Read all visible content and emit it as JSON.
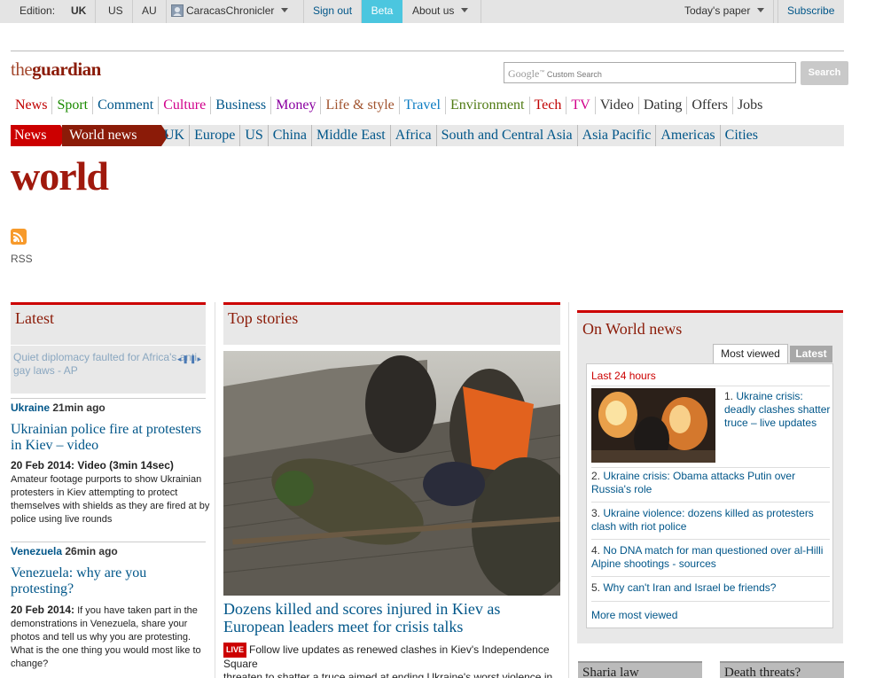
{
  "topbar": {
    "edition_label": "Edition:",
    "editions": [
      "UK",
      "US",
      "AU"
    ],
    "username": "CaracasChronicler",
    "sign_out": "Sign out",
    "beta": "Beta",
    "about": "About us",
    "todays_paper": "Today's paper",
    "subscribe": "Subscribe"
  },
  "logo": {
    "the": "the",
    "name": "guardian"
  },
  "search": {
    "brand": "Google",
    "placeholder": "Custom Search",
    "button": "Search"
  },
  "nav": [
    {
      "label": "News",
      "color": "#c00000"
    },
    {
      "label": "Sport",
      "color": "#1a8a00"
    },
    {
      "label": "Comment",
      "color": "#005689"
    },
    {
      "label": "Culture",
      "color": "#d1008b"
    },
    {
      "label": "Business",
      "color": "#005689"
    },
    {
      "label": "Money",
      "color": "#8a00a0"
    },
    {
      "label": "Life & style",
      "color": "#a0522d"
    },
    {
      "label": "Travel",
      "color": "#0a7bc2"
    },
    {
      "label": "Environment",
      "color": "#4f7a12"
    },
    {
      "label": "Tech",
      "color": "#c00000"
    },
    {
      "label": "TV",
      "color": "#d1008b"
    },
    {
      "label": "Video",
      "color": "#333333"
    },
    {
      "label": "Dating",
      "color": "#333333"
    },
    {
      "label": "Offers",
      "color": "#333333"
    },
    {
      "label": "Jobs",
      "color": "#333333"
    }
  ],
  "subnav": {
    "news": "News",
    "world_news": "World news",
    "items": [
      "UK",
      "Europe",
      "US",
      "China",
      "Middle East",
      "Africa",
      "South and Central Asia",
      "Asia Pacific",
      "Americas",
      "Cities"
    ]
  },
  "page_title": "world",
  "rss_label": "RSS",
  "latest": {
    "heading": "Latest",
    "ticker": "Quiet diplomacy faulted for Africa's anti-gay laws - AP",
    "stories": [
      {
        "section": "Ukraine",
        "age": "21min ago",
        "headline": "Ukrainian police fire at protesters in Kiev – video",
        "date": "20 Feb 2014: Video (3min 14sec)",
        "standfirst": "Amateur footage purports to show Ukrainian protesters in Kiev attempting to protect themselves with shields as they are fired at by police using live rounds"
      },
      {
        "section": "Venezuela",
        "age": "26min ago",
        "headline": "Venezuela: why are you protesting?",
        "date": "20 Feb 2014:",
        "standfirst": "If you have taken part in the demonstrations in Venezuela, share your photos and tell us why you are protesting. What is the one thing you would most like to change?"
      }
    ]
  },
  "top_stories": {
    "heading": "Top stories",
    "headline": "Dozens killed and scores injured in Kiev as European leaders meet for crisis talks",
    "live_badge": "LIVE",
    "standfirst": "Follow live updates as renewed clashes in Kiev's Independence Square",
    "standfirst2": "threaten to shatter a truce aimed at ending Ukraine's worst violence in"
  },
  "on_world_news": {
    "heading": "On World news",
    "tab_most_viewed": "Most viewed",
    "tab_latest": "Latest",
    "period": "Last 24 hours",
    "items": [
      {
        "n": "1.",
        "text": "Ukraine crisis: deadly clashes shatter truce – live updates"
      },
      {
        "n": "2.",
        "text": "Ukraine crisis: Obama attacks Putin over Russia's role"
      },
      {
        "n": "3.",
        "text": "Ukraine violence: dozens killed as protesters clash with riot police"
      },
      {
        "n": "4.",
        "text": "No DNA match for man questioned over al-Hilli Alpine shootings - sources"
      },
      {
        "n": "5.",
        "text": "Why can't Iran and Israel be friends?"
      }
    ],
    "more": "More most viewed"
  },
  "teasers": [
    "Sharia law",
    "Death threats?"
  ]
}
